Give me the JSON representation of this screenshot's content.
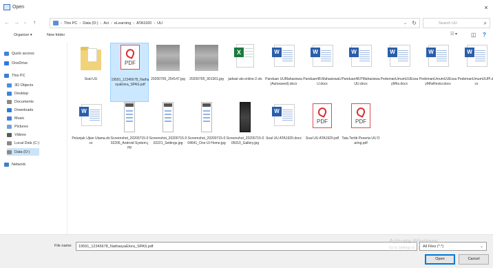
{
  "window": {
    "title": "Open",
    "close_glyph": "×"
  },
  "nav": {
    "back_glyph": "←",
    "forward_glyph": "→",
    "recent_glyph": "⌄",
    "up_glyph": "↑",
    "breadcrumbs": [
      "This PC",
      "Data (D:)",
      "Avi",
      "eLearning",
      "ATA1920",
      "UU"
    ],
    "separator": "›",
    "dropdown_glyph": "⌄",
    "refresh_glyph": "↻",
    "search_placeholder": "Search UU",
    "search_glyph": "⌕"
  },
  "toolbar": {
    "organize": "Organize ▾",
    "new_folder": "New folder",
    "view_glyph": "☷ ▾",
    "pane_glyph": "◫",
    "help_glyph": "?"
  },
  "sidebar": {
    "items": [
      {
        "label": "Quick access",
        "icon": "star-icon",
        "color": "#3f82d8"
      },
      {
        "label": "OneDrive",
        "icon": "cloud-icon",
        "color": "#2f7ad9"
      },
      {
        "label": "This PC",
        "icon": "computer-icon",
        "color": "#3d7fd3"
      },
      {
        "label": "3D Objects",
        "icon": "cube-icon",
        "color": "#4a8fdd"
      },
      {
        "label": "Desktop",
        "icon": "desktop-icon",
        "color": "#3b86d9"
      },
      {
        "label": "Documents",
        "icon": "documents-icon",
        "color": "#8a8a8a"
      },
      {
        "label": "Downloads",
        "icon": "download-icon",
        "color": "#2f7ad9"
      },
      {
        "label": "Music",
        "icon": "music-icon",
        "color": "#3f82d8"
      },
      {
        "label": "Pictures",
        "icon": "pictures-icon",
        "color": "#6fa1e0"
      },
      {
        "label": "Videos",
        "icon": "videos-icon",
        "color": "#5a5a5a"
      },
      {
        "label": "Local Disk (C:)",
        "icon": "disk-icon",
        "color": "#8a8a8a"
      },
      {
        "label": "Data (D:)",
        "icon": "disk-icon",
        "color": "#8a8a8a"
      },
      {
        "label": "Network",
        "icon": "network-icon",
        "color": "#3d7fd3"
      }
    ]
  },
  "files": [
    {
      "name": "Soal UU",
      "type": "folder"
    },
    {
      "name": "19591_12345678_NathasyaElora_SPAS.pdf",
      "type": "pdf",
      "pdf_label": "PDF"
    },
    {
      "name": "20200795_254147.jpg",
      "type": "photo"
    },
    {
      "name": "20200795_901301.jpg",
      "type": "photo"
    },
    {
      "name": "jadwal uts-online-2.xls",
      "type": "excel",
      "badge": "X"
    },
    {
      "name": "Panduan UUMahasiswa (Autosaved).docx",
      "type": "word",
      "badge": "W"
    },
    {
      "name": "Panduan48.MahasiswaUU.docx",
      "type": "word",
      "badge": "W"
    },
    {
      "name": "Panduan48.PMahasiswaUU.docx",
      "type": "word",
      "badge": "W"
    },
    {
      "name": "PedomanUmumUUEssayMhs.docx",
      "type": "word",
      "badge": "W"
    },
    {
      "name": "PedomanUmumUUEssayMhsRevisi.docx",
      "type": "word",
      "badge": "W"
    },
    {
      "name": "PedomanUmumUUPl.docx",
      "type": "word",
      "badge": "W"
    },
    {
      "name": "Petunjuk Ujian Utama.docx",
      "type": "word",
      "badge": "W"
    },
    {
      "name": "Screenshot_20200715-002206_Android System.jpg",
      "type": "phone"
    },
    {
      "name": "Screenshot_20200715-002221_Settings.jpg",
      "type": "phone"
    },
    {
      "name": "Screenshot_20200715-004641_One UI Home.jpg",
      "type": "phone"
    },
    {
      "name": "Screenshot_20200715-005010_Gallery.jpg",
      "type": "phone-dark"
    },
    {
      "name": "Soal UU ATA1920.docx",
      "type": "word",
      "badge": "W"
    },
    {
      "name": "Soal UU ATA1920.pdf",
      "type": "pdf",
      "pdf_label": "PDF"
    },
    {
      "name": "Tata Tertib Peserta UU Daring.pdf",
      "type": "pdf",
      "pdf_label": "PDF"
    }
  ],
  "footer": {
    "filename_label": "File name:",
    "filename_value": "19591_12345678_NathasyaElora_SPAS.pdf",
    "filter_value": "All Files (*.*)",
    "filter_glyph": "⌄",
    "open_label": "Open",
    "cancel_label": "Cancel",
    "watermark_title": "Activate Windows",
    "watermark_sub": "Go to Settings to activate Windows."
  }
}
